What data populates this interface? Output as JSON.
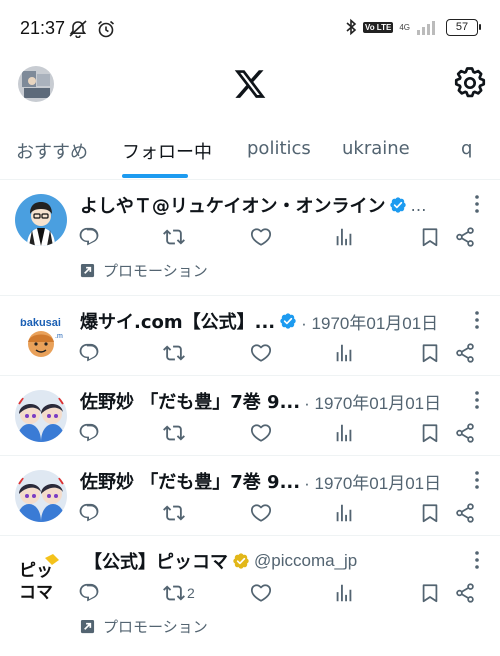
{
  "status_bar": {
    "time": "21:37",
    "network": "4G",
    "volte": "Vo LTE",
    "battery": "57"
  },
  "header": {
    "logo": "x-logo",
    "settings_icon": "gear-icon"
  },
  "tabs": [
    {
      "label": "おすすめ",
      "active": false
    },
    {
      "label": "フォロー中",
      "active": true
    },
    {
      "label": "politics",
      "active": false
    },
    {
      "label": "ukraine",
      "active": false
    },
    {
      "label": "q",
      "active": false
    }
  ],
  "tweets": [
    {
      "author": "よしやＴ@リュケイオン・オンライン",
      "verified": "blue",
      "handle_ellipsis": "…",
      "date": "",
      "retweet_count": "",
      "promoted": true,
      "promo_label": "プロモーション"
    },
    {
      "author": "爆サイ.com【公式】...",
      "verified": "blue",
      "date": "· 1970年01月01日",
      "retweet_count": "",
      "promoted": false
    },
    {
      "author": "佐野妙 「だも豊」7巻 9...",
      "verified": "",
      "date": "· 1970年01月01日",
      "retweet_count": "",
      "promoted": false
    },
    {
      "author": "佐野妙 「だも豊」7巻 9...",
      "verified": "",
      "date": "· 1970年01月01日",
      "retweet_count": "",
      "promoted": false
    },
    {
      "author": "【公式】ピッコマ",
      "verified": "gold",
      "handle": "@piccoma_jp",
      "retweet_count": "2",
      "promoted": true,
      "promo_label": "プロモーション"
    }
  ],
  "colors": {
    "accent": "#1d9bf0",
    "gold": "#e2b719",
    "secondary_text": "#536471",
    "divider": "#eff3f4"
  }
}
